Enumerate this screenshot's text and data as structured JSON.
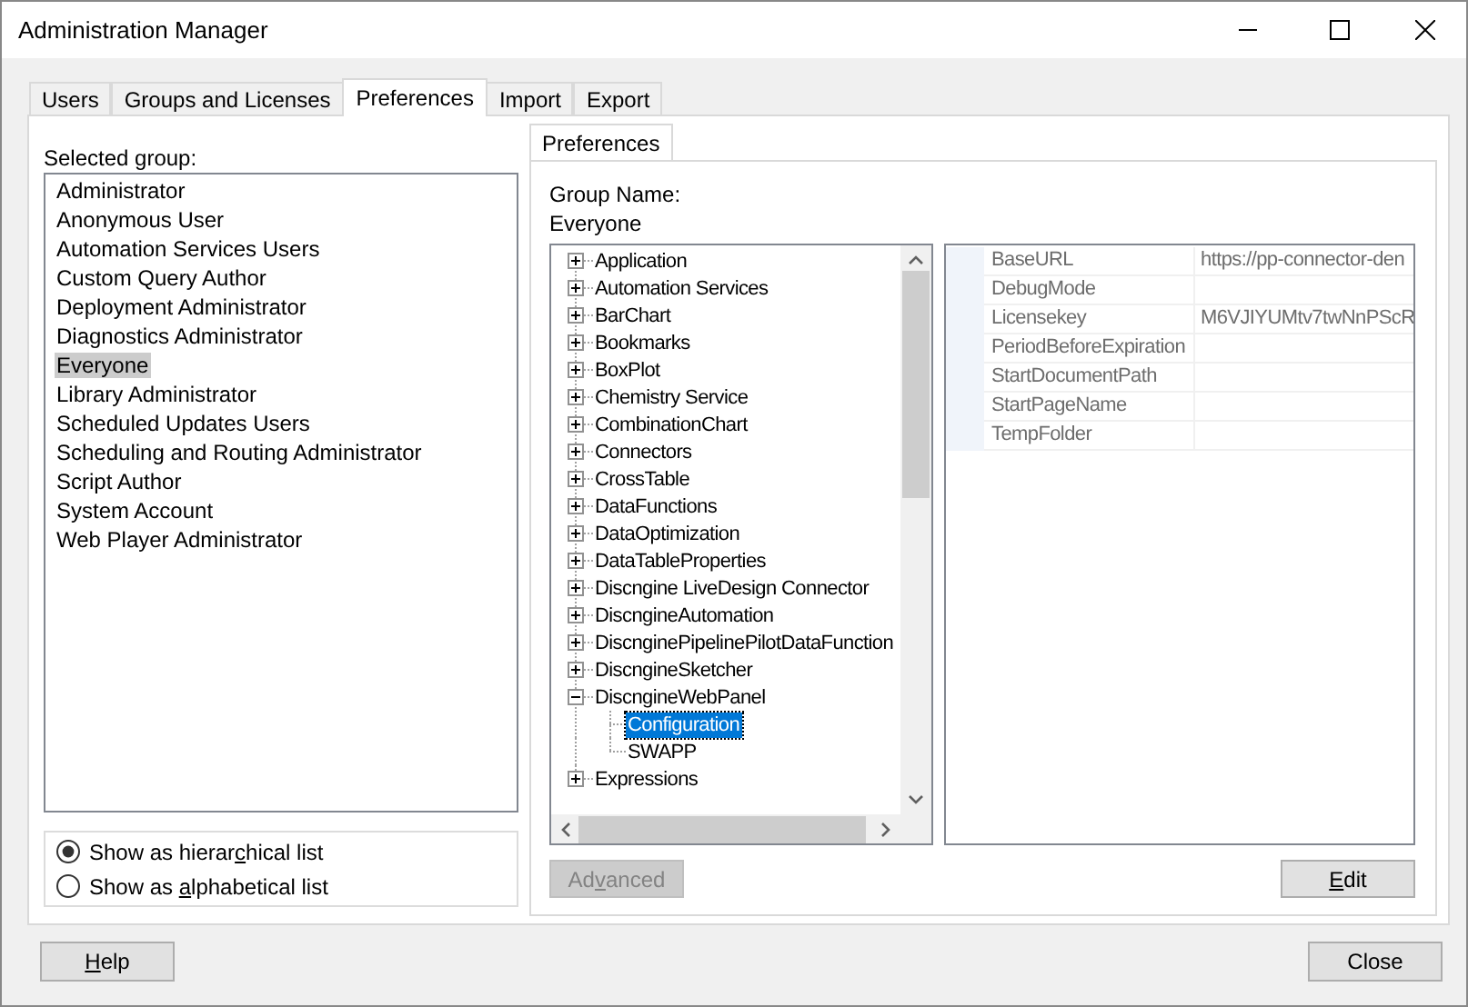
{
  "window": {
    "title": "Administration Manager"
  },
  "tabs": [
    {
      "label": "Users",
      "selected": false
    },
    {
      "label": "Groups and Licenses",
      "selected": false
    },
    {
      "label": "Preferences",
      "selected": true
    },
    {
      "label": "Import",
      "selected": false
    },
    {
      "label": "Export",
      "selected": false
    }
  ],
  "groups": {
    "label": "Selected group:",
    "items": [
      {
        "label": "Administrator",
        "selected": false
      },
      {
        "label": "Anonymous User",
        "selected": false
      },
      {
        "label": "Automation Services Users",
        "selected": false
      },
      {
        "label": "Custom Query Author",
        "selected": false
      },
      {
        "label": "Deployment Administrator",
        "selected": false
      },
      {
        "label": "Diagnostics Administrator",
        "selected": false
      },
      {
        "label": "Everyone",
        "selected": true
      },
      {
        "label": "Library Administrator",
        "selected": false
      },
      {
        "label": "Scheduled Updates Users",
        "selected": false
      },
      {
        "label": "Scheduling and Routing Administrator",
        "selected": false
      },
      {
        "label": "Script Author",
        "selected": false
      },
      {
        "label": "System Account",
        "selected": false
      },
      {
        "label": "Web Player Administrator",
        "selected": false
      }
    ]
  },
  "view_options": [
    {
      "pre": "Show as hierar",
      "key": "c",
      "post": "hical list",
      "selected": true
    },
    {
      "pre": "Show as ",
      "key": "a",
      "post": "lphabetical list",
      "selected": false
    }
  ],
  "preferences": {
    "tab": {
      "label": "Preferences",
      "selected": true
    },
    "group_name_label": "Group Name:",
    "group_name": "Everyone",
    "tree": [
      {
        "label": "Application",
        "expanded": false,
        "selected": false
      },
      {
        "label": "Automation Services",
        "expanded": false,
        "selected": false
      },
      {
        "label": "BarChart",
        "expanded": false,
        "selected": false
      },
      {
        "label": "Bookmarks",
        "expanded": false,
        "selected": false
      },
      {
        "label": "BoxPlot",
        "expanded": false,
        "selected": false
      },
      {
        "label": "Chemistry Service",
        "expanded": false,
        "selected": false
      },
      {
        "label": "CombinationChart",
        "expanded": false,
        "selected": false
      },
      {
        "label": "Connectors",
        "expanded": false,
        "selected": false
      },
      {
        "label": "CrossTable",
        "expanded": false,
        "selected": false
      },
      {
        "label": "DataFunctions",
        "expanded": false,
        "selected": false
      },
      {
        "label": "DataOptimization",
        "expanded": false,
        "selected": false
      },
      {
        "label": "DataTableProperties",
        "expanded": false,
        "selected": false
      },
      {
        "label": "Discngine LiveDesign Connector",
        "expanded": false,
        "selected": false
      },
      {
        "label": "DiscngineAutomation",
        "expanded": false,
        "selected": false
      },
      {
        "label": "DiscnginePipelinePilotDataFunction",
        "expanded": false,
        "selected": false
      },
      {
        "label": "DiscngineSketcher",
        "expanded": false,
        "selected": false
      },
      {
        "label": "DiscngineWebPanel",
        "expanded": true,
        "selected": false,
        "children": [
          {
            "label": "Configuration",
            "selected": true
          },
          {
            "label": "SWAPP",
            "selected": false
          }
        ]
      },
      {
        "label": "Expressions",
        "expanded": false,
        "selected": false
      }
    ],
    "properties": [
      {
        "name": "BaseURL",
        "value": "https://pp-connector-den"
      },
      {
        "name": "DebugMode"
      },
      {
        "name": "Licensekey",
        "value": "M6VJIYUMtv7twNnPScR"
      },
      {
        "name": "PeriodBeforeExpiration"
      },
      {
        "name": "StartDocumentPath"
      },
      {
        "name": "StartPageName"
      },
      {
        "name": "TempFolder"
      }
    ],
    "advanced_button": {
      "pre": "Ad",
      "key": "v",
      "post": "anced",
      "disabled": true
    },
    "edit_button": {
      "key": "E",
      "post": "dit",
      "disabled": false
    }
  },
  "help_button": {
    "key": "H",
    "post": "elp"
  },
  "close_button": {
    "label": "Close"
  }
}
